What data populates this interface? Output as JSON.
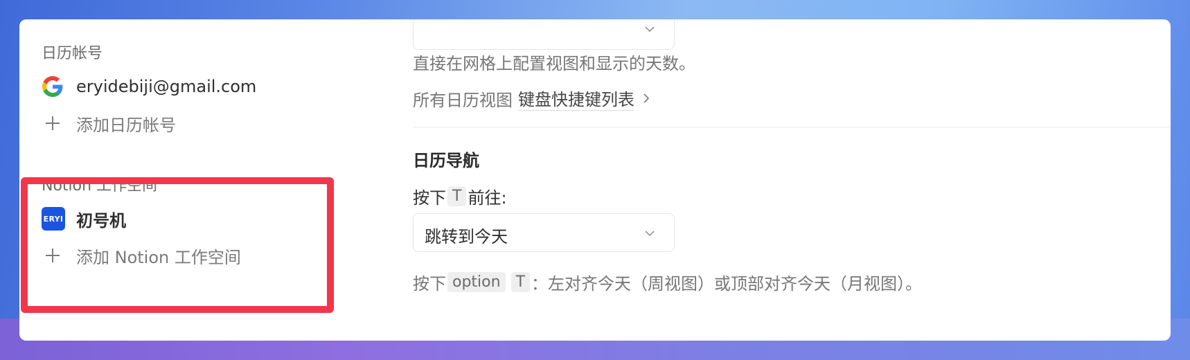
{
  "sidebar": {
    "calendar_section_label": "日历帐号",
    "account_email": "eryidebiji@gmail.com",
    "add_calendar_account": "添加日历帐号",
    "notion_section_label": "Notion 工作空间",
    "workspace_icon_text": "ERYI",
    "workspace_name": "初号机",
    "add_notion_workspace": "添加 Notion 工作空间"
  },
  "main": {
    "grid_description": "直接在网格上配置视图和显示的天数。",
    "all_views_prefix": "所有日历视图",
    "shortcuts_link": "键盘快捷键列表",
    "nav_heading": "日历导航",
    "press_label": "按下",
    "key_t": "T",
    "goto_label": "前往:",
    "jump_select_value": "跳转到今天",
    "option_key": "option",
    "option_desc": "：左对齐今天（周视图）或顶部对齐今天（月视图）。"
  },
  "colors": {
    "highlight": "#f2374a",
    "workspace_icon_bg": "#1a55e0"
  }
}
